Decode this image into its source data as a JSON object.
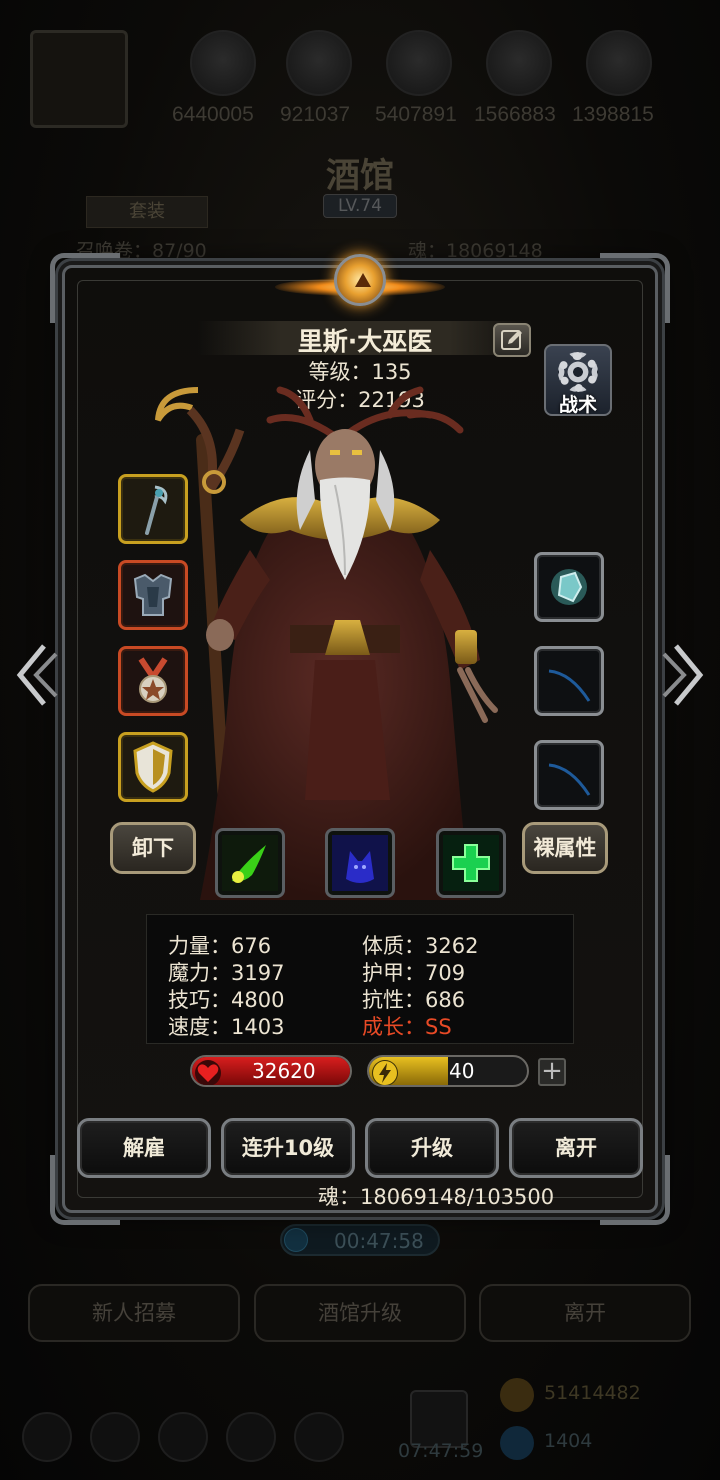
{
  "background": {
    "resources": [
      "6440005",
      "921037",
      "5407891",
      "1566883",
      "1398815"
    ],
    "title": "酒馆",
    "level_badge": "LV.74",
    "tab_label": "套装",
    "info_left": "召唤卷：87/90",
    "info_right": "魂：18069148",
    "timer": "00:47:58",
    "buttons": [
      "新人招募",
      "酒馆升级",
      "离开"
    ],
    "bottom_timer": "07:47:59",
    "gold_amount": "51414482",
    "gem_amount": "1404"
  },
  "hero": {
    "name": "里斯·大巫医",
    "level_text": "等级：135",
    "score_text": "评分：22193",
    "tactics_label": "战术"
  },
  "equipment": {
    "left_slots": [
      "staff-slot",
      "armor-slot",
      "medal-slot",
      "shield-slot"
    ],
    "right_slots": [
      "orb-slot",
      "bow-slot-1",
      "bow-slot-2"
    ]
  },
  "skills": [
    "green-blast-skill",
    "shadow-wolf-skill",
    "heal-cross-skill"
  ],
  "buttons": {
    "unequip": "卸下",
    "naked_attr": "裸属性"
  },
  "stats": {
    "strength": "力量：676",
    "magic": "魔力：3197",
    "skill": "技巧：4800",
    "speed": "速度：1403",
    "constitution": "体质：3262",
    "armor": "护甲：709",
    "resistance": "抗性：686",
    "growth": "成长：SS"
  },
  "hp": {
    "value": "32620",
    "fill": 1.0,
    "color": "#d81e1e"
  },
  "energy": {
    "value": "40",
    "fill": 0.5,
    "color": "#e8c020"
  },
  "actions": {
    "dismiss": "解雇",
    "level_up_10": "连升10级",
    "level_up": "升级",
    "leave": "离开"
  },
  "soul": "魂：18069148/103500"
}
